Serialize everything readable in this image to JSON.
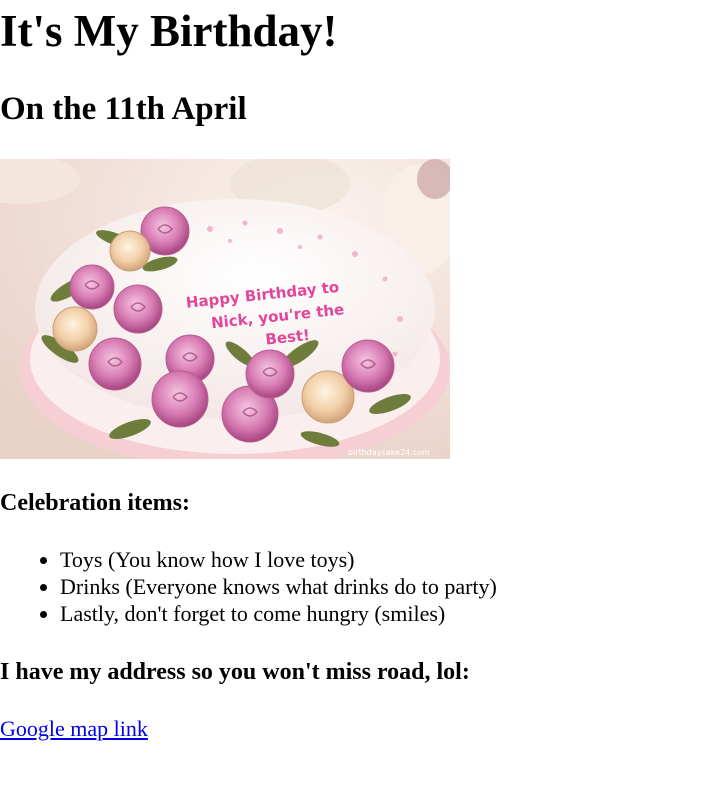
{
  "heading": {
    "title": "It's My Birthday!",
    "date": "On the 11th April"
  },
  "cake_image": {
    "message_line1": "Happy Birthday to",
    "message_line2": "Nick, you're the",
    "message_line3": "Best!",
    "watermark": "birthdaycake24.com",
    "colors": {
      "background": "#f4e2dc",
      "frosting": "#fbf5f3",
      "plate": "#f6cfd4",
      "rose_pink": "#d97fb8",
      "rose_cream": "#f3d2b2",
      "leaf": "#6e7d3c",
      "text": "#e0479a"
    }
  },
  "celebration": {
    "heading": "Celebration items:",
    "items": [
      "Toys (You know how I love toys)",
      "Drinks (Everyone knows what drinks do to party)",
      "Lastly, don't forget to come hungry (smiles)"
    ]
  },
  "address": {
    "heading": "I have my address so you won't miss road, lol:",
    "link_label": "Google map link"
  }
}
